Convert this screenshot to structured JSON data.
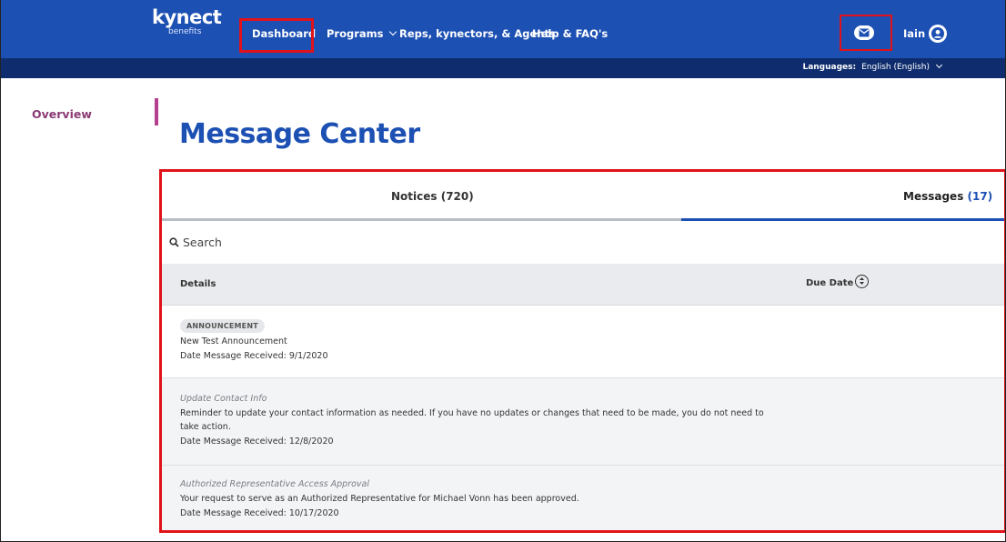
{
  "header": {
    "logo_text": "kynect",
    "logo_sub": "benefits",
    "nav": {
      "dashboard": "Dashboard",
      "programs": "Programs",
      "reps": "Reps, kynectors, & Agents",
      "help": "Help & FAQ's"
    },
    "user_name": "Iain",
    "mail_icon": "envelope-icon",
    "avatar_icon": "user-avatar-icon"
  },
  "language_bar": {
    "label": "Languages:",
    "value": "English (English)"
  },
  "sidebar": {
    "items": [
      {
        "label": "Overview"
      }
    ]
  },
  "page": {
    "title": "Message Center"
  },
  "tabs": {
    "notices": {
      "label": "Notices",
      "count": "(720)"
    },
    "messages": {
      "label": "Messages",
      "count": "(17)"
    }
  },
  "search": {
    "placeholder": "Search"
  },
  "table": {
    "headers": {
      "details": "Details",
      "due_date": "Due Date"
    },
    "rows": [
      {
        "badge": "ANNOUNCEMENT",
        "title": "New Test Announcement",
        "received": "Date Message Received: 9/1/2020"
      },
      {
        "subject": "Update Contact Info",
        "body_line1": "Reminder to update your contact information as needed. If you have no updates or changes that need to be made, you do not need to",
        "body_line2": "take action.",
        "received": "Date Message Received: 12/8/2020"
      },
      {
        "subject": "Authorized Representative Access Approval",
        "body_line1": "Your request to serve as an Authorized Representative for Michael Vonn has been approved.",
        "received": "Date Message Received: 10/17/2020"
      }
    ]
  },
  "colors": {
    "header_blue": "#1c50b3",
    "language_bar": "#0f2d6e",
    "highlight_red": "#e0121a",
    "overview_accent": "#b43f8f"
  }
}
